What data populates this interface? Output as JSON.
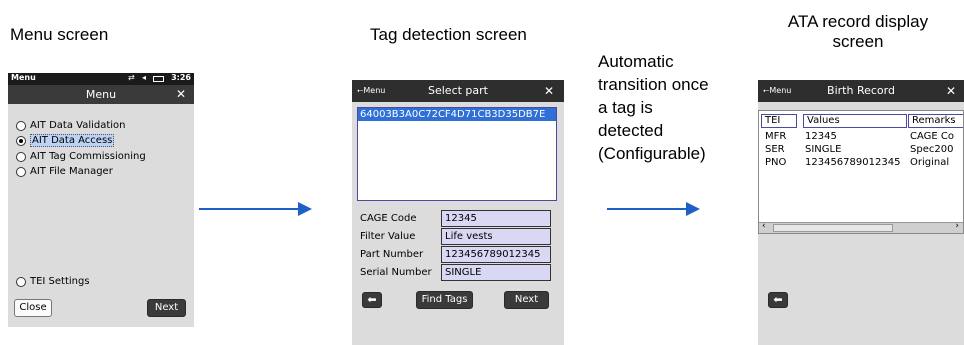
{
  "captions": {
    "menu": "Menu screen",
    "tag_detection": "Tag detection screen",
    "ata_line1": "ATA record display",
    "ata_line2": "screen"
  },
  "transition_note": [
    "Automatic",
    "transition once",
    "a tag is",
    "detected",
    "(Configurable)"
  ],
  "menu_screen": {
    "status_app": "Menu",
    "status_time": "3:26",
    "title": "Menu",
    "options": [
      {
        "label": "AIT Data Validation",
        "selected": false
      },
      {
        "label": "AIT Data Access",
        "selected": true
      },
      {
        "label": "AIT Tag Commissioning",
        "selected": false
      },
      {
        "label": "AIT File Manager",
        "selected": false
      }
    ],
    "settings_option": "TEI Settings",
    "close_label": "Close",
    "next_label": "Next"
  },
  "tag_screen": {
    "menu_label": "Menu",
    "title": "Select part",
    "tag_id": "64003B3A0C72CF4D71CB3D35DB7E",
    "fields": [
      {
        "label": "CAGE Code",
        "value": "12345"
      },
      {
        "label": "Filter Value",
        "value": "Life vests"
      },
      {
        "label": "Part Number",
        "value": "123456789012345"
      },
      {
        "label": "Serial Number",
        "value": "SINGLE"
      }
    ],
    "find_tags_label": "Find Tags",
    "next_label": "Next"
  },
  "record_screen": {
    "menu_label": "Menu",
    "title": "Birth Record",
    "columns": [
      "TEI",
      "Values",
      "Remarks"
    ],
    "rows": [
      [
        "MFR",
        "12345",
        "CAGE Co"
      ],
      [
        "SER",
        "SINGLE",
        "Spec200"
      ],
      [
        "PNO",
        "123456789012345",
        "Original"
      ]
    ]
  }
}
